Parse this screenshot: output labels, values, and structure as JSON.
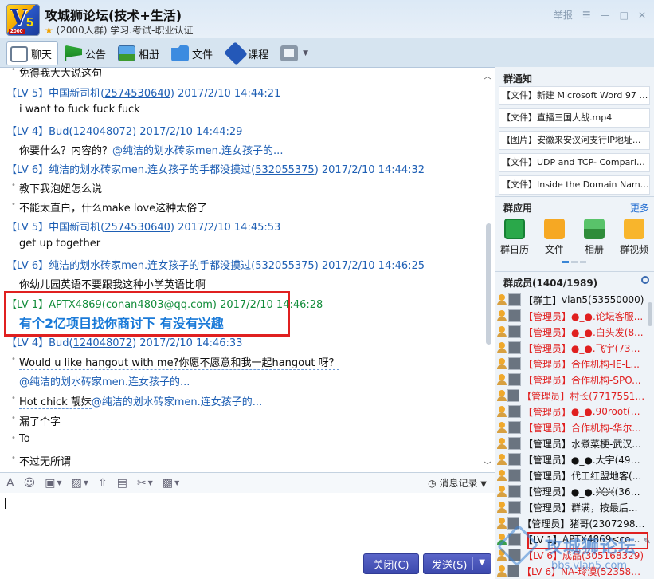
{
  "window": {
    "title": "攻城狮论坛(技术+生活)",
    "subtitle": "(2000人群) 学习.考试-职业认证",
    "logo_text": "V5",
    "logo_year": "2000",
    "report": "举报",
    "controls": [
      "☰",
      "—",
      "□",
      "✕"
    ]
  },
  "tabs": [
    {
      "label": "聊天",
      "icon": "chat-bubble-icon",
      "active": true
    },
    {
      "label": "公告",
      "icon": "flag-icon"
    },
    {
      "label": "相册",
      "icon": "photo-icon"
    },
    {
      "label": "文件",
      "icon": "folder-icon"
    },
    {
      "label": "课程",
      "icon": "course-icon"
    }
  ],
  "messages": {
    "m0": "免得我大大说这句",
    "m1_lv": "【LV 5】",
    "m1_name": "中国新司机(",
    "m1_id": "2574530640",
    "m1_time": ") 2017/2/10 14:44:21",
    "m1_text": "i want to fuck fuck fuck",
    "m2_lv": "【LV 4】",
    "m2_name": "Bud(",
    "m2_id": "124048072",
    "m2_time": ") 2017/2/10 14:44:29",
    "m2_text": "你要什么？内容的？",
    "m2_mention": "@纯洁的划水砖家men.连女孩子的...",
    "m3_lv": "【LV 6】",
    "m3_name": "纯洁的划水砖家men.连女孩子的手都没摸过(",
    "m3_id": "532055375",
    "m3_time": ") 2017/2/10 14:44:32",
    "m3_text1": "教下我泡妞怎么说",
    "m3_text2": "不能太直白，什么make love这种太俗了",
    "m4_lv": "【LV 5】",
    "m4_name": "中国新司机(",
    "m4_id": "2574530640",
    "m4_time": ") 2017/2/10 14:45:53",
    "m4_text": "get up together",
    "m5_lv": "【LV 6】",
    "m5_name": "纯洁的划水砖家men.连女孩子的手都没摸过(",
    "m5_id": "532055375",
    "m5_time": ") 2017/2/10 14:46:25",
    "m5_text": "你幼儿园英语不要跟我这种小学英语比啊",
    "m6_lv": "【LV 1】",
    "m6_name": "APTX4869(",
    "m6_id": "conan4803@qq.com",
    "m6_time": ") 2017/2/10 14:46:28",
    "m6_text": "有个2亿项目找你商讨下  有没有兴趣",
    "m7_lv": "【LV 4】",
    "m7_name": "Bud(",
    "m7_id": "124048072",
    "m7_time": ") 2017/2/10 14:46:33",
    "m7_text1": "Would u like hangout with me?你愿不愿意和我一起hangout 呀？",
    "m7_mention1": "@纯洁的划水砖家men.连女孩子的...",
    "m7_text2": "Hot chick 靓妹",
    "m7_mention2": "@纯洁的划水砖家men.连女孩子的...",
    "m7_text3": "漏了个字",
    "m7_text4": "To",
    "m7_text5": "不过无所谓"
  },
  "input": {
    "history_label": "消息记录",
    "close_label": "关闭(C)",
    "send_label": "发送(S)"
  },
  "right": {
    "notice_title": "群通知",
    "notices": [
      "【文件】新建 Microsoft Word 97 - 2...",
      "【文件】直播三国大战.mp4",
      "【图片】安徽来安汊河支行IP地址...",
      "【文件】UDP and TCP- Comparison o...",
      "【文件】Inside the Domain Name Sy..."
    ],
    "apps_title": "群应用",
    "more": "更多",
    "apps": [
      "群日历",
      "文件",
      "相册",
      "群视频"
    ],
    "members_title": "群成员(1404/1989)",
    "members": [
      {
        "role": "【群主】",
        "name": "vlan5(53550000)",
        "color": "black"
      },
      {
        "role": "【管理员】",
        "name": "●_●.论坛客服...",
        "color": "red"
      },
      {
        "role": "【管理员】",
        "name": "●_●.白头发(8...",
        "color": "red"
      },
      {
        "role": "【管理员】",
        "name": "●_●.飞宇(734...",
        "color": "red"
      },
      {
        "role": "【管理员】",
        "name": "合作机构-IE-L...",
        "color": "red"
      },
      {
        "role": "【管理员】",
        "name": "合作机构-SPO...",
        "color": "red"
      },
      {
        "role": "【管理员】",
        "name": "村长(771755154)",
        "color": "red"
      },
      {
        "role": "【管理员】",
        "name": "●_●.90root(5...",
        "color": "red"
      },
      {
        "role": "【管理员】",
        "name": "合作机构-华尔...",
        "color": "red"
      },
      {
        "role": "【管理员】",
        "name": "水煮菜梗-武汉...",
        "color": "black"
      },
      {
        "role": "【管理员】",
        "name": "●_●.大宇(493...",
        "color": "black"
      },
      {
        "role": "【管理员】",
        "name": "代工红盟地客(...",
        "color": "black"
      },
      {
        "role": "【管理员】",
        "name": "●_●.兴兴(365...",
        "color": "black"
      },
      {
        "role": "【管理员】",
        "name": "群满，按最后...",
        "color": "black"
      },
      {
        "role": "【管理员】",
        "name": "猪哥(23072984...",
        "color": "black"
      },
      {
        "role": "【LV 1】",
        "name": "APTX4869<con...",
        "color": "black"
      },
      {
        "role": "【LV 6】",
        "name": "成品(305168329)",
        "color": "red"
      },
      {
        "role": "【LV 6】",
        "name": "NA-玲漠(5235820...",
        "color": "red"
      }
    ]
  },
  "watermark": {
    "text": "攻城狮论坛",
    "url": "bbs.vlan5.com"
  }
}
